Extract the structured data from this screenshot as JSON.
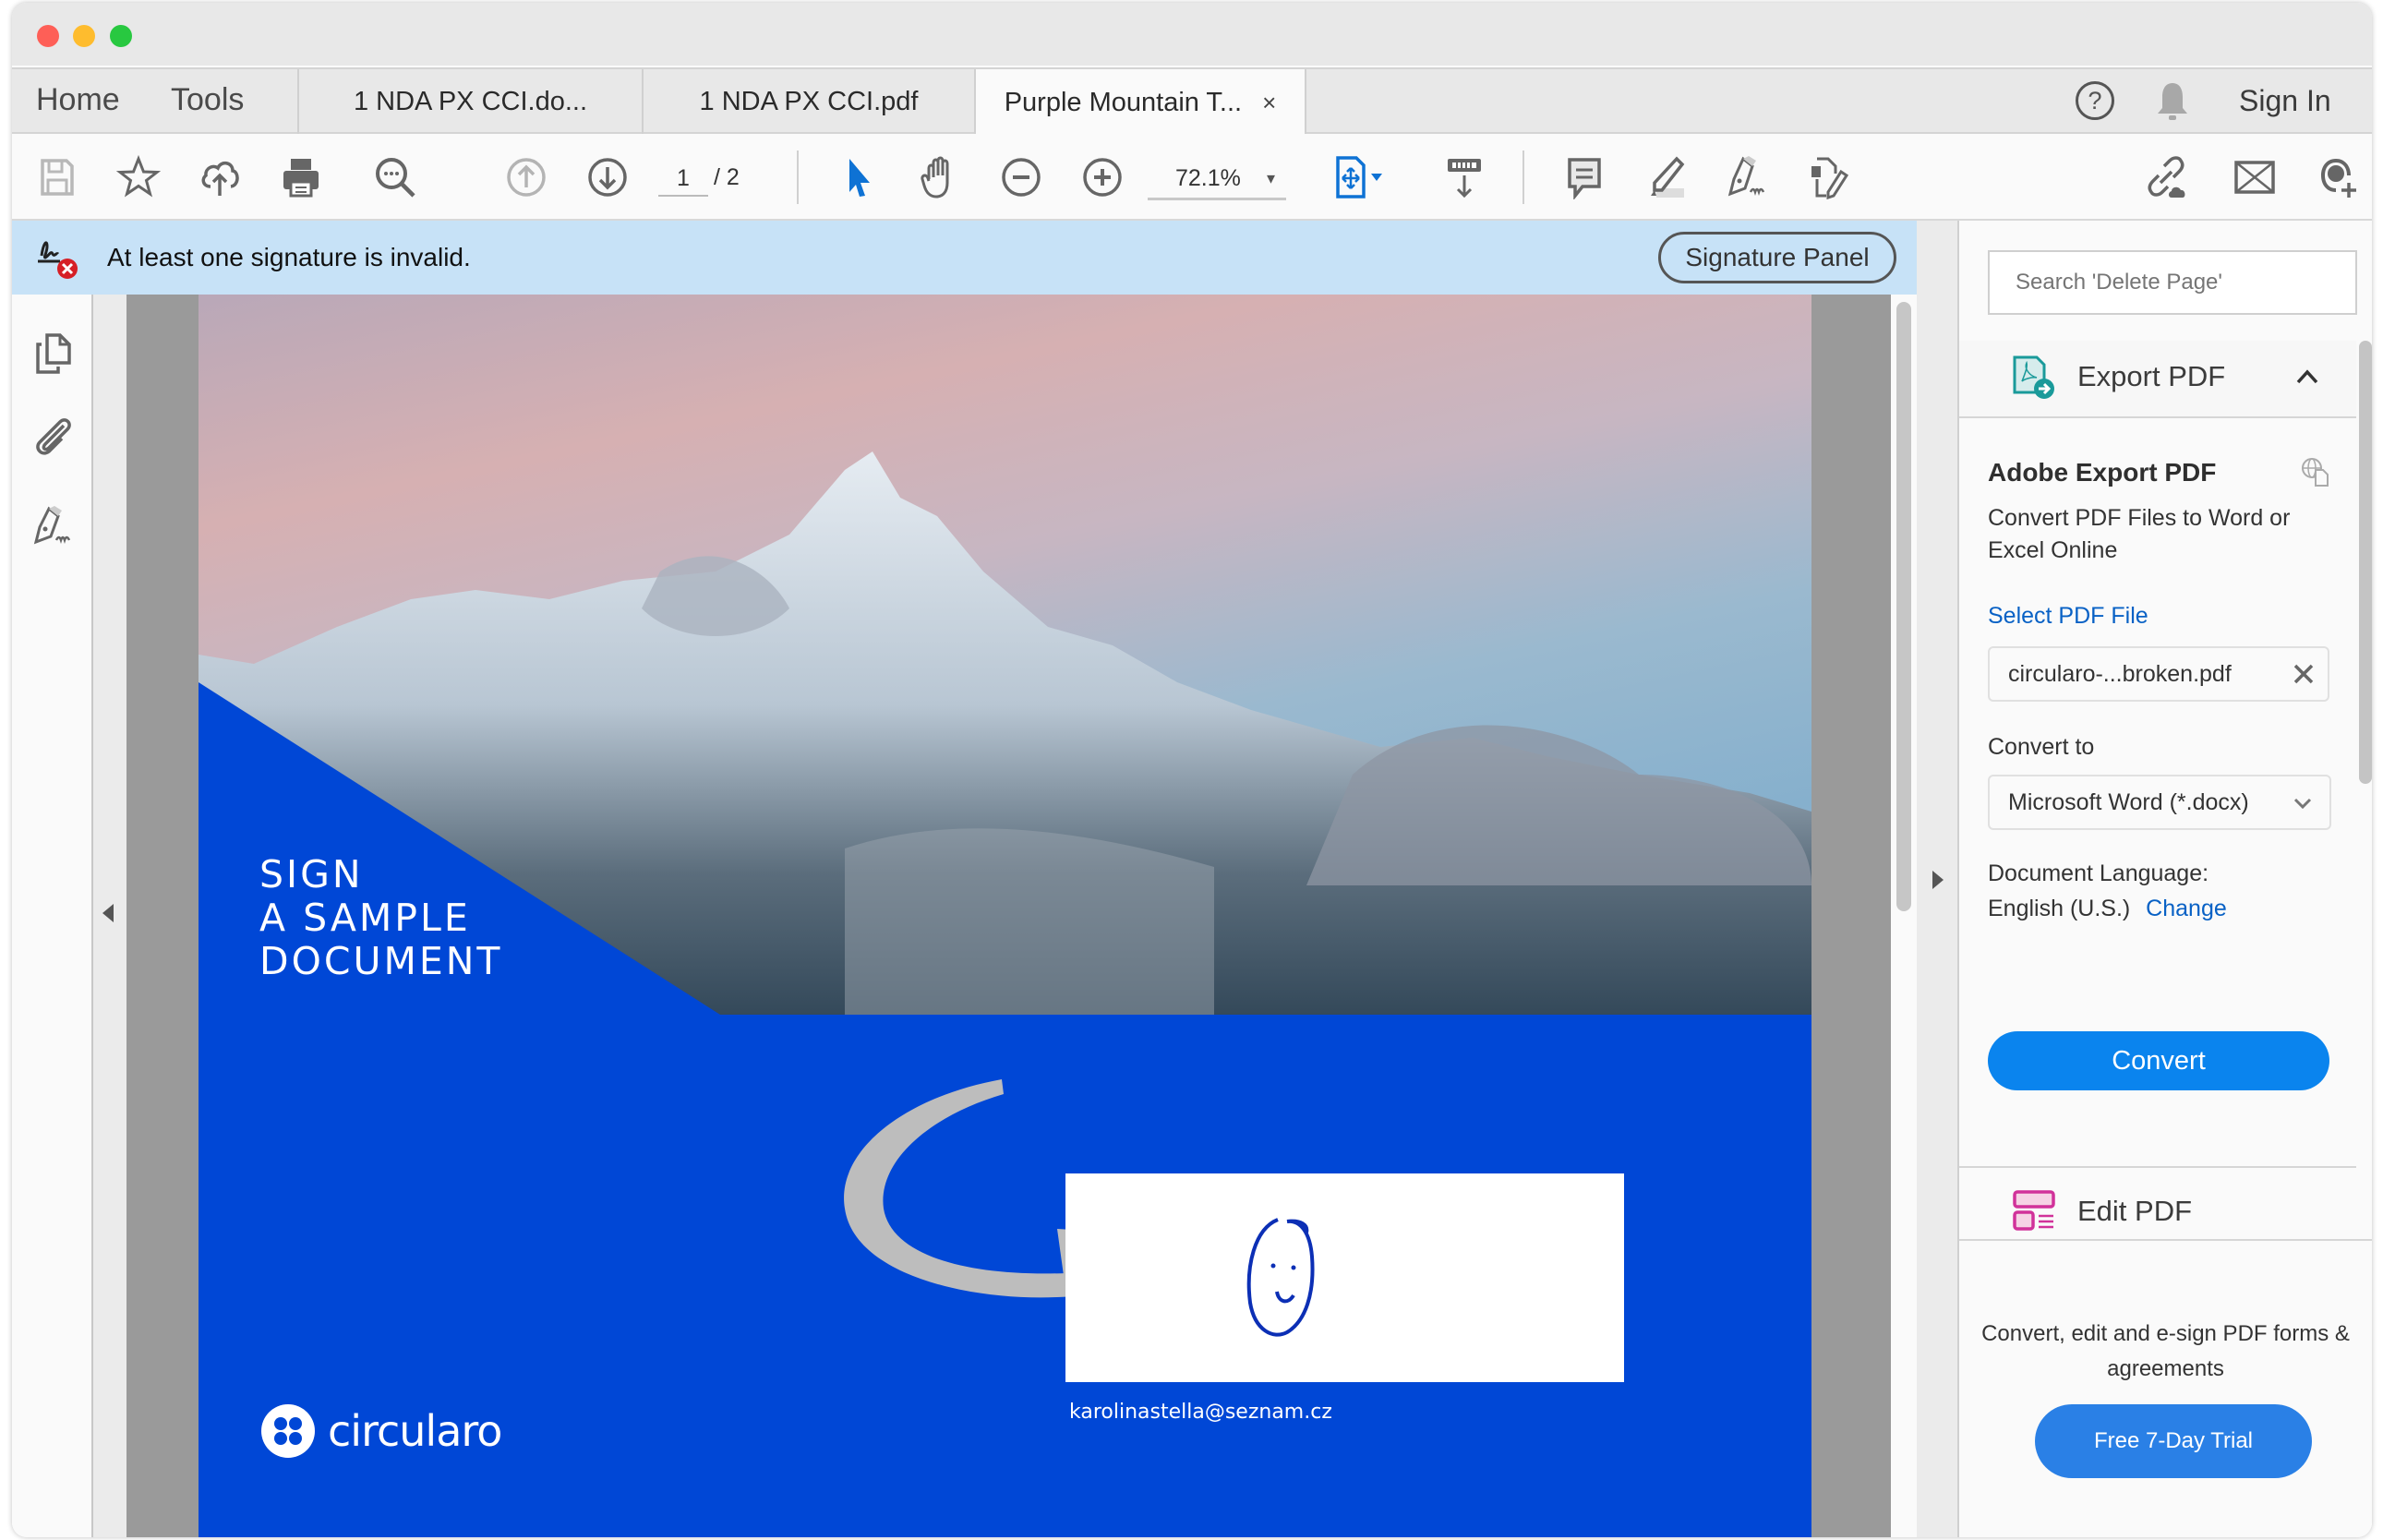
{
  "window": {
    "traffic_lights": [
      "close",
      "minimize",
      "zoom"
    ]
  },
  "nav": {
    "home": "Home",
    "tools": "Tools"
  },
  "tabs": [
    {
      "label": "1 NDA PX CCI.do...",
      "active": false
    },
    {
      "label": "1 NDA PX CCI.pdf",
      "active": false
    },
    {
      "label": "Purple Mountain T...",
      "active": true,
      "close": "×"
    }
  ],
  "header_right": {
    "help_glyph": "?",
    "sign_in": "Sign In"
  },
  "toolbar": {
    "left_icons": [
      "save-icon",
      "bookmark-star-icon",
      "cloud-upload-icon",
      "print-icon",
      "find-icon"
    ],
    "page_current": "1",
    "page_total": "/ 2",
    "nav_icons": [
      "page-up-icon",
      "page-down-icon"
    ],
    "tools": [
      "select-arrow-icon",
      "hand-icon",
      "zoom-out-icon",
      "zoom-in-icon"
    ],
    "zoom_level": "72.1%",
    "zoom_caret": "▾",
    "view_icons": [
      "fit-page-icon",
      "scroll-mode-icon"
    ],
    "annotate_icons": [
      "comment-icon",
      "highlight-icon",
      "sign-icon",
      "fill-edit-icon"
    ],
    "share_icons": [
      "share-link-icon",
      "email-icon",
      "add-user-icon"
    ]
  },
  "signature_bar": {
    "message": "At least one signature is invalid.",
    "button": "Signature Panel",
    "background": "#c7e2f7"
  },
  "left_sidebar": {
    "icons": [
      "page-thumbnails-icon",
      "attachments-icon",
      "signatures-icon"
    ]
  },
  "document": {
    "headline": [
      "SIGN",
      "A SAMPLE",
      "DOCUMENT"
    ],
    "signer_email": "karolinastella@seznam.cz",
    "brand": "circularo",
    "brand_color": "#0047d6"
  },
  "right_panel": {
    "search_placeholder": "Search 'Delete Page'",
    "export_section": {
      "label": "Export PDF",
      "title": "Adobe Export PDF",
      "description": "Convert PDF Files to Word or Excel Online",
      "select_file_label": "Select PDF File",
      "selected_file": "circularo-...broken.pdf",
      "convert_to_label": "Convert to",
      "convert_to_value": "Microsoft Word (*.docx)",
      "language_label": "Document Language:",
      "language_value": "English (U.S.)",
      "language_change": "Change",
      "convert_button": "Convert",
      "accent": "#0a84ee"
    },
    "edit_section": {
      "label": "Edit PDF"
    },
    "promo": {
      "text": "Convert, edit and e-sign PDF forms & agreements",
      "button": "Free 7-Day Trial"
    }
  }
}
